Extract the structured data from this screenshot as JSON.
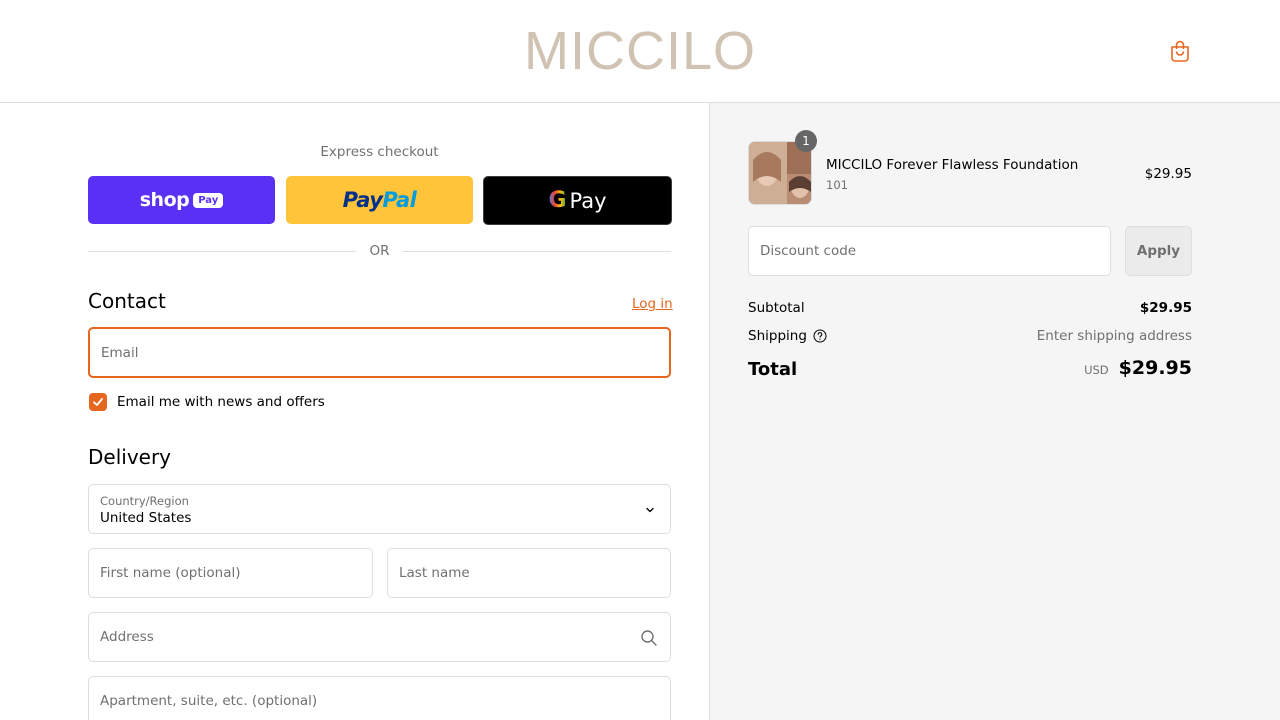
{
  "header": {
    "logo": "MICCILO",
    "cart_icon": "shopping-bag-icon"
  },
  "express": {
    "title": "Express checkout",
    "shop_pay": {
      "word": "shop",
      "pill": "Pay"
    },
    "paypal": {
      "part_a": "Pay",
      "part_b": "Pal"
    },
    "gpay": {
      "g": "G",
      "word": "Pay"
    },
    "or_text": "OR"
  },
  "contact": {
    "title": "Contact",
    "login": "Log in",
    "email_placeholder": "Email",
    "newsletter_label": "Email me with news and offers",
    "newsletter_checked": true
  },
  "delivery": {
    "title": "Delivery",
    "country_label": "Country/Region",
    "country_value": "United States",
    "first_name_placeholder": "First name (optional)",
    "last_name_placeholder": "Last name",
    "address_placeholder": "Address",
    "apartment_placeholder": "Apartment, suite, etc. (optional)"
  },
  "summary": {
    "product": {
      "quantity": "1",
      "name": "MICCILO Forever Flawless Foundation",
      "variant": "101",
      "price": "$29.95"
    },
    "discount_placeholder": "Discount code",
    "apply_label": "Apply",
    "subtotal_label": "Subtotal",
    "subtotal_value": "$29.95",
    "shipping_label": "Shipping",
    "shipping_value": "Enter shipping address",
    "total_label": "Total",
    "total_currency": "USD",
    "total_value": "$29.95"
  },
  "colors": {
    "accent": "#e5661e",
    "logo": "#d1c3b4",
    "shop_pay": "#5a31f4",
    "paypal": "#ffc439",
    "gpay": "#000000"
  }
}
